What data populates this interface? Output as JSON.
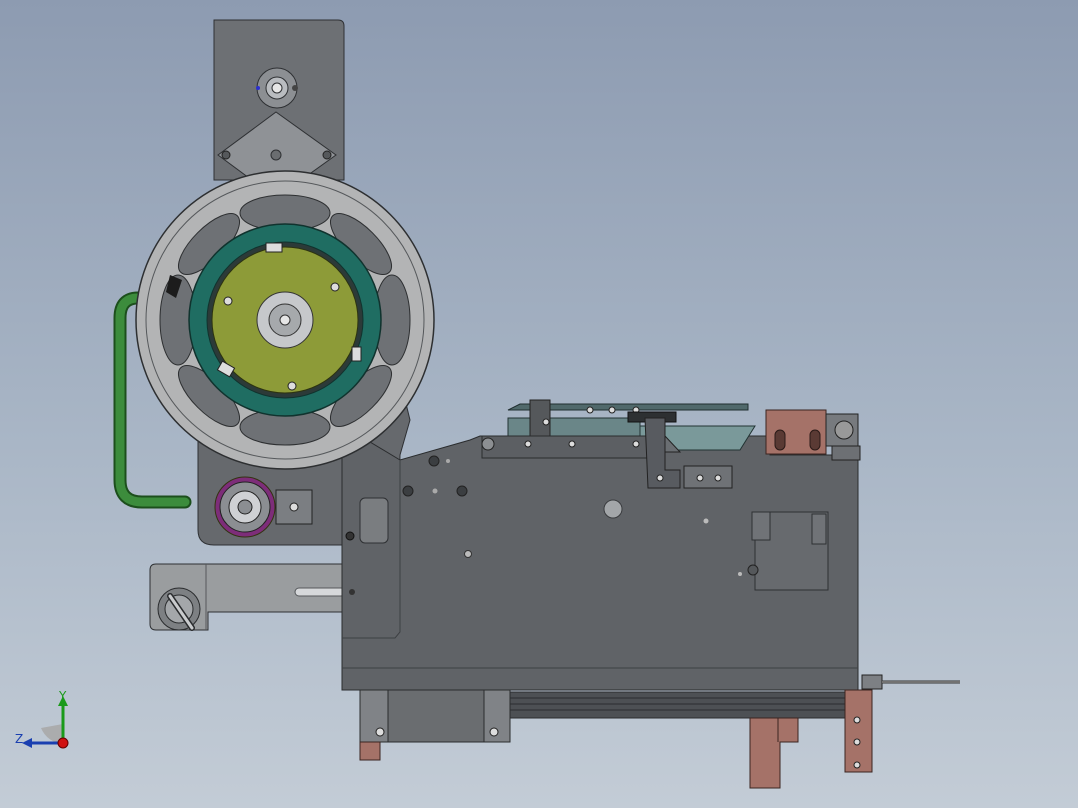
{
  "viewport": {
    "background_top": "#8d9bb1",
    "background_bottom": "#c3ccd6"
  },
  "triad": {
    "y_label": "Y",
    "z_label": "Z",
    "y_color": "#1a9a1a",
    "z_color": "#1a3fb0",
    "x_color": "#d01010"
  },
  "model": {
    "plate_color": "#6b6e72",
    "feeder_reel_color": "#b5b5b5",
    "hub_color": "#8d9b38",
    "ring_color": "#1f6d62",
    "hose_color": "#2f7a2f",
    "bracket_color": "#a57268"
  }
}
